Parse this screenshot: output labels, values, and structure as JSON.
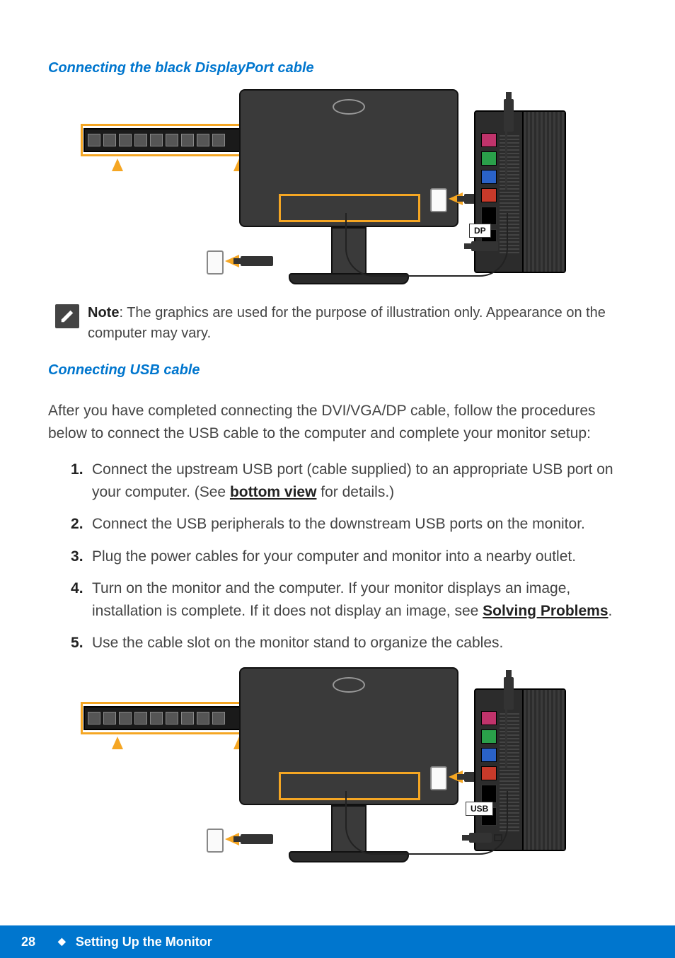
{
  "headings": {
    "dp": "Connecting the black DisplayPort cable",
    "usb": "Connecting USB cable"
  },
  "note": {
    "label": "Note",
    "text": ": The graphics are used for the purpose of illustration only. Appearance on the computer may vary."
  },
  "intro": "After you have completed connecting the DVI/VGA/DP cable, follow the procedures below to connect the USB cable to the computer and complete your monitor setup:",
  "steps": {
    "s1a": "Connect the upstream USB port (cable supplied) to an appropriate USB port on your computer. (See ",
    "s1_link": "bottom view",
    "s1b": " for details.)",
    "s2": "Connect the USB peripherals to the downstream USB ports on the monitor.",
    "s3": "Plug the power cables for your computer and monitor into a nearby outlet.",
    "s4a": "Turn on the monitor and the computer. If your monitor displays an image, installation is complete. If it does not display an image, see ",
    "s4_link": "Solving Problems",
    "s4b": ".",
    "s5": "Use the cable slot on the monitor stand to organize the cables."
  },
  "diagram": {
    "port_label_dp": "DP",
    "port_label_usb": "USB"
  },
  "footer": {
    "page": "28",
    "section": "Setting Up the Monitor"
  }
}
